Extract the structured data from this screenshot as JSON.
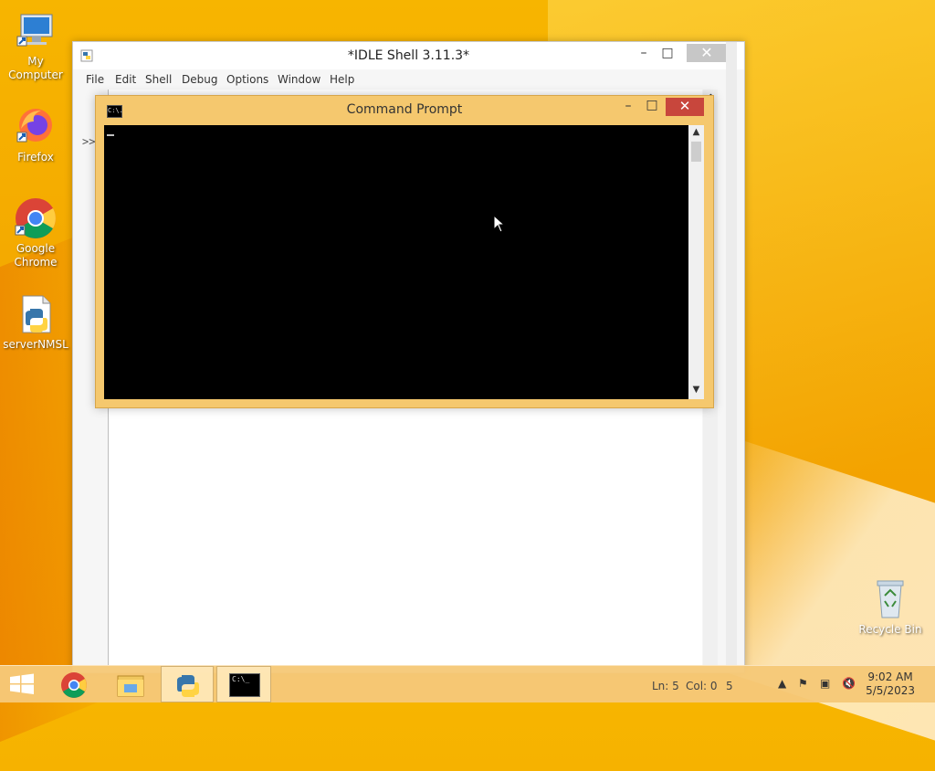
{
  "desktop": {
    "icons": [
      {
        "label": "My Computer"
      },
      {
        "label": "Firefox"
      },
      {
        "label": "Google Chrome"
      },
      {
        "label": "serverNMSL"
      },
      {
        "label": "Recycle Bin"
      }
    ]
  },
  "idle": {
    "title": "*IDLE Shell 3.11.3*",
    "menu": [
      "File",
      "Edit",
      "Shell",
      "Debug",
      "Options",
      "Window",
      "Help"
    ],
    "prompt": ">>",
    "status": {
      "ln": "Ln: 5",
      "col": "Col: 0",
      "extra": "5"
    }
  },
  "cmd": {
    "title": "Command Prompt",
    "icon_text": "C:\\."
  },
  "taskbar": {
    "clock_time": "9:02 AM",
    "clock_date": "5/5/2023",
    "cmd_thumb_text": "C:\\_"
  },
  "colors": {
    "desktop": "#f4a900",
    "cmd_frame": "#f5c86e",
    "close_red": "#c8463c"
  }
}
